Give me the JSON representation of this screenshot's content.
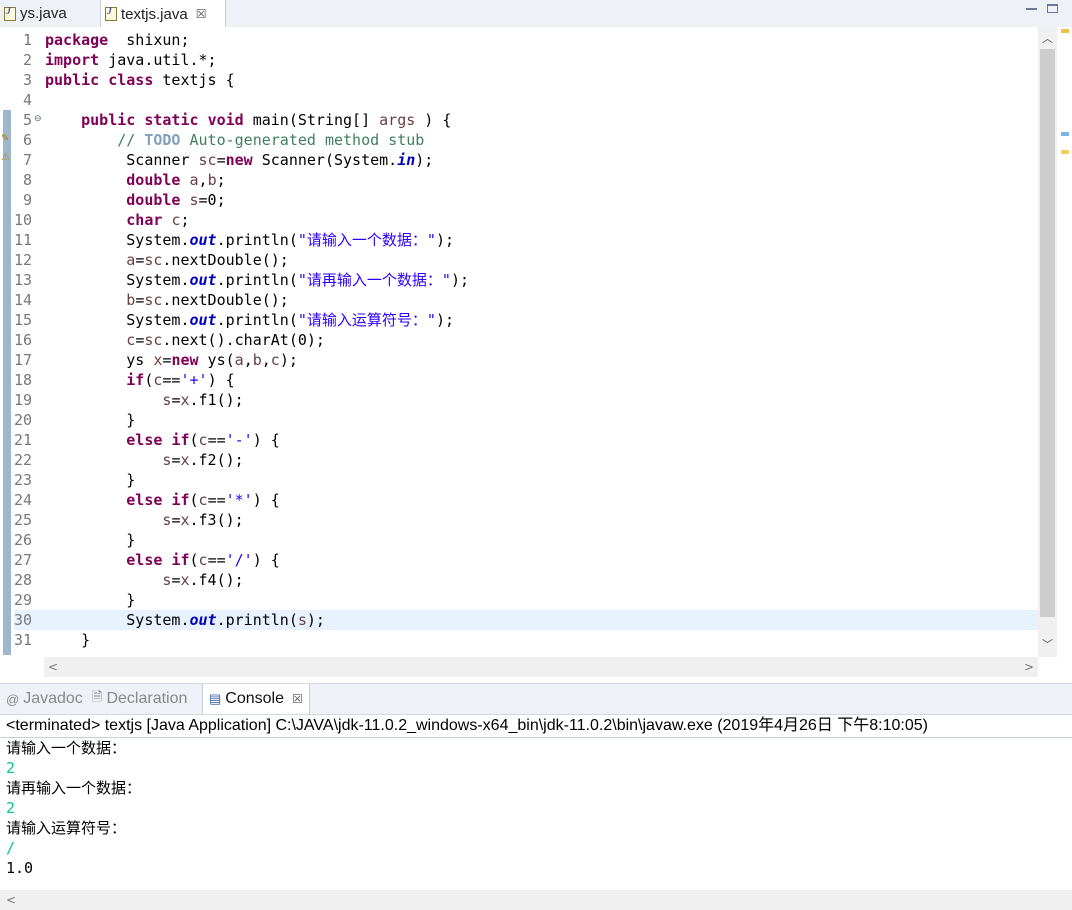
{
  "editor_tabs": [
    {
      "label": "ys.java",
      "active": false
    },
    {
      "label": "textjs.java",
      "active": true,
      "close": "☒"
    }
  ],
  "code_lines": [
    {
      "n": "1",
      "tokens": [
        [
          "kw",
          "package"
        ],
        [
          "",
          "  shixun;"
        ]
      ]
    },
    {
      "n": "2",
      "tokens": [
        [
          "kw",
          "import"
        ],
        [
          "",
          " java.util.*;"
        ]
      ]
    },
    {
      "n": "3",
      "tokens": [
        [
          "kw",
          "public"
        ],
        [
          "",
          " "
        ],
        [
          "kw",
          "class"
        ],
        [
          "",
          " textjs {"
        ]
      ]
    },
    {
      "n": "4",
      "tokens": []
    },
    {
      "n": "5",
      "tokens": [
        [
          "",
          "    "
        ],
        [
          "kw",
          "public"
        ],
        [
          "",
          " "
        ],
        [
          "kw",
          "static"
        ],
        [
          "",
          " "
        ],
        [
          "kw",
          "void"
        ],
        [
          "",
          " main(String[] "
        ],
        [
          "var",
          "args"
        ],
        [
          "",
          " ) {"
        ]
      ]
    },
    {
      "n": "6",
      "tokens": [
        [
          "",
          "        "
        ],
        [
          "cm",
          "// "
        ],
        [
          "todo",
          "TODO"
        ],
        [
          "cm",
          " Auto-generated method stub"
        ]
      ]
    },
    {
      "n": "7",
      "tokens": [
        [
          "",
          "         Scanner "
        ],
        [
          "var",
          "sc"
        ],
        [
          "",
          "="
        ],
        [
          "kw",
          "new"
        ],
        [
          "",
          " Scanner(System."
        ],
        [
          "fld",
          "in"
        ],
        [
          "",
          ");"
        ]
      ]
    },
    {
      "n": "8",
      "tokens": [
        [
          "",
          "         "
        ],
        [
          "kw",
          "double"
        ],
        [
          "",
          " "
        ],
        [
          "var",
          "a"
        ],
        [
          "",
          ","
        ],
        [
          "var",
          "b"
        ],
        [
          "",
          ";"
        ]
      ]
    },
    {
      "n": "9",
      "tokens": [
        [
          "",
          "         "
        ],
        [
          "kw",
          "double"
        ],
        [
          "",
          " "
        ],
        [
          "var",
          "s"
        ],
        [
          "",
          "=0;"
        ]
      ]
    },
    {
      "n": "10",
      "tokens": [
        [
          "",
          "         "
        ],
        [
          "kw",
          "char"
        ],
        [
          "",
          " "
        ],
        [
          "var",
          "c"
        ],
        [
          "",
          ";"
        ]
      ]
    },
    {
      "n": "11",
      "tokens": [
        [
          "",
          "         System."
        ],
        [
          "fld",
          "out"
        ],
        [
          "",
          ".println("
        ],
        [
          "str",
          "\"请输入一个数据：\""
        ],
        [
          "",
          ");"
        ]
      ]
    },
    {
      "n": "12",
      "tokens": [
        [
          "",
          "         "
        ],
        [
          "var",
          "a"
        ],
        [
          "",
          "="
        ],
        [
          "var",
          "sc"
        ],
        [
          "",
          ".nextDouble();"
        ]
      ]
    },
    {
      "n": "13",
      "tokens": [
        [
          "",
          "         System."
        ],
        [
          "fld",
          "out"
        ],
        [
          "",
          ".println("
        ],
        [
          "str",
          "\"请再输入一个数据：\""
        ],
        [
          "",
          ");"
        ]
      ]
    },
    {
      "n": "14",
      "tokens": [
        [
          "",
          "         "
        ],
        [
          "var",
          "b"
        ],
        [
          "",
          "="
        ],
        [
          "var",
          "sc"
        ],
        [
          "",
          ".nextDouble();"
        ]
      ]
    },
    {
      "n": "15",
      "tokens": [
        [
          "",
          "         System."
        ],
        [
          "fld",
          "out"
        ],
        [
          "",
          ".println("
        ],
        [
          "str",
          "\"请输入运算符号：\""
        ],
        [
          "",
          ");"
        ]
      ]
    },
    {
      "n": "16",
      "tokens": [
        [
          "",
          "         "
        ],
        [
          "var",
          "c"
        ],
        [
          "",
          "="
        ],
        [
          "var",
          "sc"
        ],
        [
          "",
          ".next().charAt(0);"
        ]
      ]
    },
    {
      "n": "17",
      "tokens": [
        [
          "",
          "         ys "
        ],
        [
          "var",
          "x"
        ],
        [
          "",
          "="
        ],
        [
          "kw",
          "new"
        ],
        [
          "",
          " ys("
        ],
        [
          "var",
          "a"
        ],
        [
          "",
          ","
        ],
        [
          "var",
          "b"
        ],
        [
          "",
          ","
        ],
        [
          "var",
          "c"
        ],
        [
          "",
          ");"
        ]
      ]
    },
    {
      "n": "18",
      "tokens": [
        [
          "",
          "         "
        ],
        [
          "kw",
          "if"
        ],
        [
          "",
          "("
        ],
        [
          "var",
          "c"
        ],
        [
          "",
          "=="
        ],
        [
          "str",
          "'+'"
        ],
        [
          "",
          ") {"
        ]
      ]
    },
    {
      "n": "19",
      "tokens": [
        [
          "",
          "             "
        ],
        [
          "var",
          "s"
        ],
        [
          "",
          "="
        ],
        [
          "var",
          "x"
        ],
        [
          "",
          ".f1();"
        ]
      ]
    },
    {
      "n": "20",
      "tokens": [
        [
          "",
          "         }"
        ]
      ]
    },
    {
      "n": "21",
      "tokens": [
        [
          "",
          "         "
        ],
        [
          "kw",
          "else"
        ],
        [
          "",
          " "
        ],
        [
          "kw",
          "if"
        ],
        [
          "",
          "("
        ],
        [
          "var",
          "c"
        ],
        [
          "",
          "=="
        ],
        [
          "str",
          "'-'"
        ],
        [
          "",
          ") {"
        ]
      ]
    },
    {
      "n": "22",
      "tokens": [
        [
          "",
          "             "
        ],
        [
          "var",
          "s"
        ],
        [
          "",
          "="
        ],
        [
          "var",
          "x"
        ],
        [
          "",
          ".f2();"
        ]
      ]
    },
    {
      "n": "23",
      "tokens": [
        [
          "",
          "         }"
        ]
      ]
    },
    {
      "n": "24",
      "tokens": [
        [
          "",
          "         "
        ],
        [
          "kw",
          "else"
        ],
        [
          "",
          " "
        ],
        [
          "kw",
          "if"
        ],
        [
          "",
          "("
        ],
        [
          "var",
          "c"
        ],
        [
          "",
          "=="
        ],
        [
          "str",
          "'*'"
        ],
        [
          "",
          ") {"
        ]
      ]
    },
    {
      "n": "25",
      "tokens": [
        [
          "",
          "             "
        ],
        [
          "var",
          "s"
        ],
        [
          "",
          "="
        ],
        [
          "var",
          "x"
        ],
        [
          "",
          ".f3();"
        ]
      ]
    },
    {
      "n": "26",
      "tokens": [
        [
          "",
          "         }"
        ]
      ]
    },
    {
      "n": "27",
      "tokens": [
        [
          "",
          "         "
        ],
        [
          "kw",
          "else"
        ],
        [
          "",
          " "
        ],
        [
          "kw",
          "if"
        ],
        [
          "",
          "("
        ],
        [
          "var",
          "c"
        ],
        [
          "",
          "=="
        ],
        [
          "str",
          "'/'"
        ],
        [
          "",
          ") {"
        ]
      ]
    },
    {
      "n": "28",
      "tokens": [
        [
          "",
          "             "
        ],
        [
          "var",
          "s"
        ],
        [
          "",
          "="
        ],
        [
          "var",
          "x"
        ],
        [
          "",
          ".f4();"
        ]
      ]
    },
    {
      "n": "29",
      "tokens": [
        [
          "",
          "         }"
        ]
      ]
    },
    {
      "n": "30",
      "tokens": [
        [
          "",
          "         System."
        ],
        [
          "fld",
          "out"
        ],
        [
          "",
          ".println("
        ],
        [
          "var",
          "s"
        ],
        [
          "",
          ");"
        ]
      ],
      "current": true
    },
    {
      "n": "31",
      "tokens": [
        [
          "",
          "    }"
        ]
      ]
    }
  ],
  "view_tabs": [
    {
      "label": "Javadoc",
      "icon": "@",
      "active": false
    },
    {
      "label": "Declaration",
      "icon": "🗎",
      "active": false
    },
    {
      "label": "Console",
      "icon": "▤",
      "active": true,
      "close": "☒"
    }
  ],
  "console": {
    "header": "<terminated> textjs [Java Application] C:\\JAVA\\jdk-11.0.2_windows-x64_bin\\jdk-11.0.2\\bin\\javaw.exe (2019年4月26日 下午8:10:05)",
    "lines": [
      {
        "text": "请输入一个数据：",
        "kind": "out"
      },
      {
        "text": "2",
        "kind": "in"
      },
      {
        "text": "请再输入一个数据：",
        "kind": "out"
      },
      {
        "text": "2",
        "kind": "in"
      },
      {
        "text": "请输入运算符号：",
        "kind": "out"
      },
      {
        "text": "/",
        "kind": "in"
      },
      {
        "text": "1.0",
        "kind": "out"
      }
    ]
  },
  "scroll_glyphs": {
    "up": "︿",
    "down": "﹀",
    "left": "<",
    "right": ">"
  }
}
